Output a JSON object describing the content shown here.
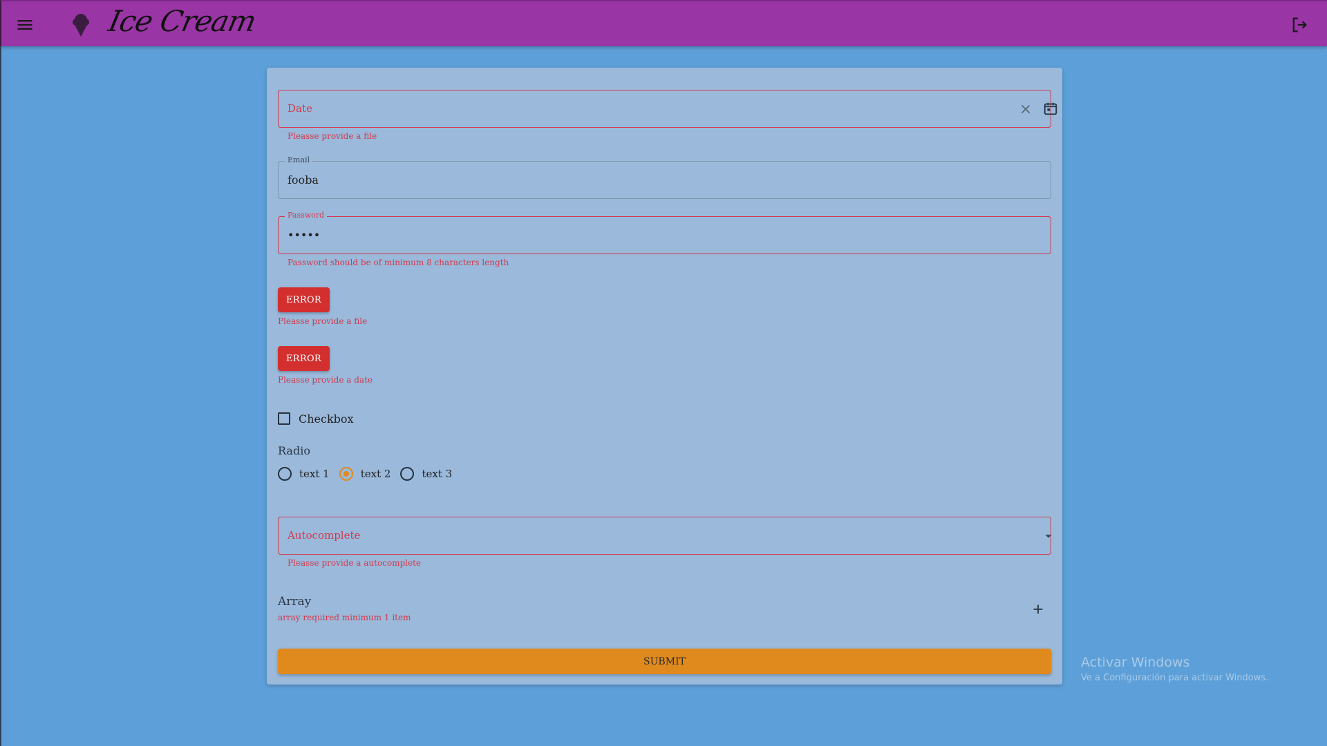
{
  "app": {
    "brand": "Ice Cream"
  },
  "icons": {
    "menu": "hamburger-menu-icon",
    "logo": "ice-cream-cone-icon",
    "logout": "logout-icon",
    "clear": "close-icon",
    "calendar": "calendar-icon",
    "dropdown": "arrow-drop-down-icon",
    "add": "plus-icon"
  },
  "colors": {
    "appbar": "#9a35a6",
    "background": "#5d9fd8",
    "card": "#9ab9db",
    "error": "#d32f2f",
    "accent": "#e08a1e"
  },
  "form": {
    "date": {
      "placeholder": "Date",
      "error": "Pleasse provide a file"
    },
    "email": {
      "label": "Email",
      "value": "fooba"
    },
    "password": {
      "label": "Password",
      "value": "•••••",
      "error": "Password should be of minimum 8 characters length"
    },
    "file_button": {
      "label": "ERROR",
      "error": "Pleasse provide a file"
    },
    "date_button": {
      "label": "ERROR",
      "error": "Pleasse provide a date"
    },
    "checkbox": {
      "label": "Checkbox",
      "checked": false
    },
    "radio": {
      "title": "Radio",
      "options": [
        "text 1",
        "text 2",
        "text 3"
      ],
      "selected": "text 2"
    },
    "autocomplete": {
      "placeholder": "Autocomplete",
      "error": "Pleasse provide a autocomplete"
    },
    "array": {
      "title": "Array",
      "error": "array required minimum 1 item"
    },
    "submit_label": "SUBMIT"
  },
  "watermark": {
    "title": "Activar Windows",
    "subtitle": "Ve a Configuración para activar Windows."
  }
}
